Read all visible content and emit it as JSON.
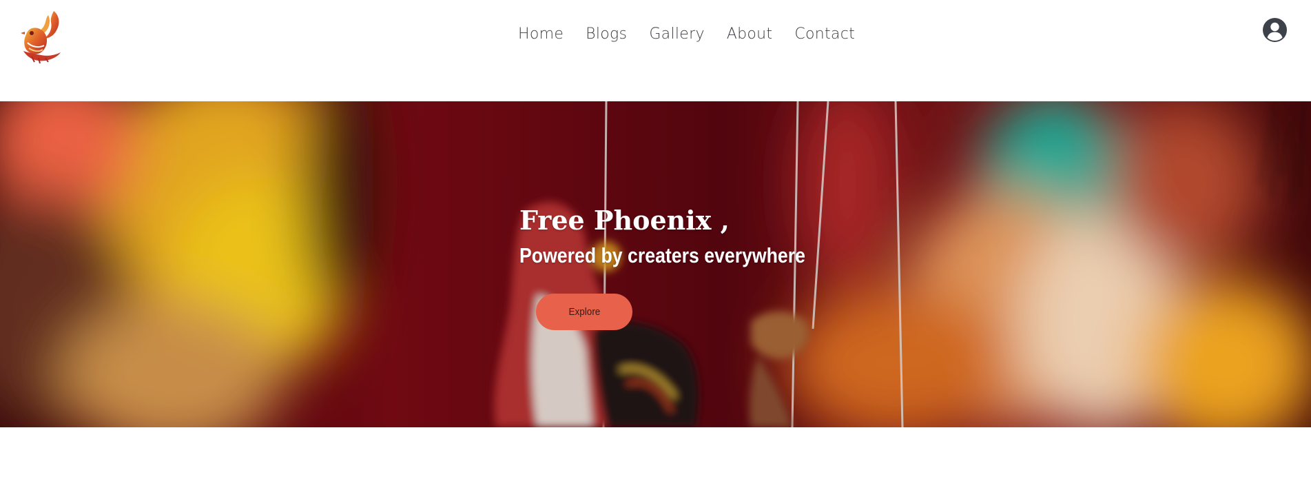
{
  "nav": {
    "items": [
      {
        "label": "Home"
      },
      {
        "label": "Blogs"
      },
      {
        "label": "Gallery"
      },
      {
        "label": "About"
      },
      {
        "label": "Contact"
      }
    ]
  },
  "hero": {
    "title": "Free Phoenix ,",
    "subtitle": "Powered by creaters everywhere",
    "cta_label": "Explore"
  },
  "colors": {
    "accent": "#e8624b",
    "nav_text": "#3a3d42",
    "account_icon": "#3d424a"
  },
  "icons": {
    "logo": "phoenix-logo",
    "account": "user-circle-icon"
  }
}
